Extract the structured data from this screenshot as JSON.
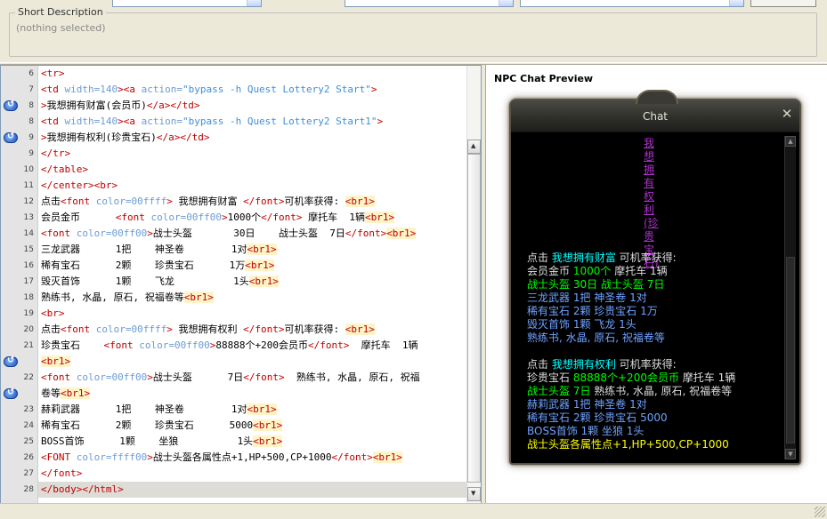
{
  "short_description": {
    "legend": "Short Description",
    "value": "(nothing selected)"
  },
  "editor": {
    "lines": [
      {
        "n": "6",
        "bookmark": false,
        "hl": false,
        "segs": [
          [
            "t",
            "<tr>"
          ]
        ]
      },
      {
        "n": "7",
        "bookmark": false,
        "hl": false,
        "segs": [
          [
            "t",
            "<td "
          ],
          [
            "a",
            "width=140"
          ],
          [
            "t",
            "><a "
          ],
          [
            "a",
            "action="
          ],
          [
            "v",
            "\"bypass -h Quest Lottery2 Start\""
          ],
          [
            "t",
            ">"
          ]
        ]
      },
      {
        "n": "8",
        "bookmark": true,
        "hl": false,
        "segs": [
          [
            "t",
            ">"
          ],
          [
            "x",
            "我想拥有财富(会员币)"
          ],
          [
            "t",
            "</a></td>"
          ]
        ]
      },
      {
        "n": "8",
        "bookmark": false,
        "hl": false,
        "segs": [
          [
            "t",
            "<td "
          ],
          [
            "a",
            "width=140"
          ],
          [
            "t",
            "><a "
          ],
          [
            "a",
            "action="
          ],
          [
            "v",
            "\"bypass -h Quest Lottery2 Start1\""
          ],
          [
            "t",
            ">"
          ]
        ]
      },
      {
        "n": "9",
        "bookmark": true,
        "hl": false,
        "segs": [
          [
            "t",
            ">"
          ],
          [
            "x",
            "我想拥有权利(珍贵宝石)"
          ],
          [
            "t",
            "</a></td>"
          ]
        ]
      },
      {
        "n": "9",
        "bookmark": false,
        "hl": false,
        "segs": [
          [
            "t",
            "</tr>"
          ]
        ]
      },
      {
        "n": "10",
        "bookmark": false,
        "hl": false,
        "segs": [
          [
            "t",
            "</table>"
          ]
        ]
      },
      {
        "n": "11",
        "bookmark": false,
        "hl": false,
        "segs": [
          [
            "t",
            "</center><br>"
          ]
        ]
      },
      {
        "n": "12",
        "bookmark": false,
        "hl": false,
        "segs": [
          [
            "x",
            "点击"
          ],
          [
            "t",
            "<font "
          ],
          [
            "a",
            "color=00ffff"
          ],
          [
            "t",
            "> "
          ],
          [
            "x",
            "我想拥有财富 "
          ],
          [
            "t",
            "</font>"
          ],
          [
            "x",
            "可机率获得: "
          ],
          [
            "b",
            "<br1>"
          ]
        ]
      },
      {
        "n": "13",
        "bookmark": false,
        "hl": false,
        "segs": [
          [
            "x",
            "会员金币      "
          ],
          [
            "t",
            "<font "
          ],
          [
            "a",
            "color=00ff00"
          ],
          [
            "t",
            ">"
          ],
          [
            "x",
            "1000个"
          ],
          [
            "t",
            "</font> "
          ],
          [
            "x",
            "摩托车  1辆"
          ],
          [
            "b",
            "<br1>"
          ]
        ]
      },
      {
        "n": "14",
        "bookmark": false,
        "hl": false,
        "segs": [
          [
            "t",
            "<font "
          ],
          [
            "a",
            "color=00ff00"
          ],
          [
            "t",
            ">"
          ],
          [
            "x",
            "战士头盔       30日    战士头盔  7日"
          ],
          [
            "t",
            "</font>"
          ],
          [
            "b",
            "<br1>"
          ]
        ]
      },
      {
        "n": "15",
        "bookmark": false,
        "hl": false,
        "segs": [
          [
            "x",
            "三龙武器      1把    神圣卷        1对"
          ],
          [
            "b",
            "<br1>"
          ]
        ]
      },
      {
        "n": "16",
        "bookmark": false,
        "hl": false,
        "segs": [
          [
            "x",
            "稀有宝石      2颗    珍贵宝石      1万"
          ],
          [
            "b",
            "<br1>"
          ]
        ]
      },
      {
        "n": "17",
        "bookmark": false,
        "hl": false,
        "segs": [
          [
            "x",
            "毁灭首饰      1颗    飞龙          1头"
          ],
          [
            "b",
            "<br1>"
          ]
        ]
      },
      {
        "n": "18",
        "bookmark": false,
        "hl": false,
        "segs": [
          [
            "x",
            "熟练书, 水晶, 原石, 祝福卷等"
          ],
          [
            "b",
            "<br1>"
          ]
        ]
      },
      {
        "n": "19",
        "bookmark": false,
        "hl": false,
        "segs": [
          [
            "t",
            "<br>"
          ]
        ]
      },
      {
        "n": "20",
        "bookmark": false,
        "hl": false,
        "segs": [
          [
            "x",
            "点击"
          ],
          [
            "t",
            "<font "
          ],
          [
            "a",
            "color=00ffff"
          ],
          [
            "t",
            "> "
          ],
          [
            "x",
            "我想拥有权利 "
          ],
          [
            "t",
            "</font>"
          ],
          [
            "x",
            "可机率获得: "
          ],
          [
            "b",
            "<br1>"
          ]
        ]
      },
      {
        "n": "21",
        "bookmark": false,
        "hl": false,
        "segs": [
          [
            "x",
            "珍贵宝石    "
          ],
          [
            "t",
            "<font "
          ],
          [
            "a",
            "color=00ff00"
          ],
          [
            "t",
            ">"
          ],
          [
            "x",
            "88888个+200会员币"
          ],
          [
            "t",
            "</font>  "
          ],
          [
            "x",
            "摩托车  1辆"
          ]
        ]
      },
      {
        "n": "",
        "bookmark": true,
        "hl": false,
        "segs": [
          [
            "b",
            "<br1>"
          ]
        ]
      },
      {
        "n": "22",
        "bookmark": false,
        "hl": false,
        "segs": [
          [
            "t",
            "<font "
          ],
          [
            "a",
            "color=00ff00"
          ],
          [
            "t",
            ">"
          ],
          [
            "x",
            "战士头盔      7日"
          ],
          [
            "t",
            "</font>  "
          ],
          [
            "x",
            "熟练书, 水晶, 原石, 祝福"
          ]
        ]
      },
      {
        "n": "",
        "bookmark": true,
        "hl": false,
        "segs": [
          [
            "x",
            "卷等"
          ],
          [
            "b",
            "<br1>"
          ]
        ]
      },
      {
        "n": "23",
        "bookmark": false,
        "hl": false,
        "segs": [
          [
            "x",
            "赫莉武器      1把    神圣卷        1对"
          ],
          [
            "b",
            "<br1>"
          ]
        ]
      },
      {
        "n": "24",
        "bookmark": false,
        "hl": false,
        "segs": [
          [
            "x",
            "稀有宝石      2颗    珍贵宝石      5000"
          ],
          [
            "b",
            "<br1>"
          ]
        ]
      },
      {
        "n": "25",
        "bookmark": false,
        "hl": false,
        "segs": [
          [
            "x",
            "BOSS首饰      1颗    坐狼          1头"
          ],
          [
            "b",
            "<br1>"
          ]
        ]
      },
      {
        "n": "26",
        "bookmark": false,
        "hl": false,
        "segs": [
          [
            "t",
            "<FONT "
          ],
          [
            "a",
            "color=ffff00"
          ],
          [
            "t",
            ">"
          ],
          [
            "x",
            "战士头盔各属性点+1,HP+500,CP+1000"
          ],
          [
            "t",
            "</font>"
          ],
          [
            "b",
            "<br1>"
          ]
        ]
      },
      {
        "n": "27",
        "bookmark": false,
        "hl": false,
        "segs": [
          [
            "t",
            "</font>"
          ]
        ]
      },
      {
        "n": "28",
        "bookmark": false,
        "hl": true,
        "segs": [
          [
            "t",
            "</body></html>"
          ]
        ]
      }
    ]
  },
  "preview": {
    "title": "NPC Chat Preview",
    "chat": {
      "title": "Chat",
      "close": "✕",
      "link": "我想拥有权利(珍贵宝石)",
      "lines": [
        [
          [
            "white",
            "点击 "
          ],
          [
            "cyan",
            "我想拥有财富"
          ],
          [
            "white",
            " 可机率获得:"
          ]
        ],
        [
          [
            "white",
            "会员金币 "
          ],
          [
            "green",
            "1000个"
          ],
          [
            "white",
            " 摩托车 1辆"
          ]
        ],
        [
          [
            "green",
            "战士头盔 30日 战士头盔 7日"
          ]
        ],
        [
          [
            "blue",
            "三龙武器 1把 神圣卷 1对"
          ]
        ],
        [
          [
            "blue",
            "稀有宝石 2颗 珍贵宝石 1万"
          ]
        ],
        [
          [
            "blue",
            "毁灭首饰 1颗 飞龙 1头"
          ]
        ],
        [
          [
            "blue",
            "熟练书, 水晶, 原石, 祝福卷等"
          ]
        ],
        [
          [
            "white",
            " "
          ]
        ],
        [
          [
            "white",
            "点击 "
          ],
          [
            "cyan",
            "我想拥有权利"
          ],
          [
            "white",
            " 可机率获得:"
          ]
        ],
        [
          [
            "white",
            "珍贵宝石 "
          ],
          [
            "green",
            "88888个+200会员币"
          ],
          [
            "white",
            " 摩托车 1辆"
          ]
        ],
        [
          [
            "green",
            "战士头盔 7日 "
          ],
          [
            "white",
            "熟练书, 水晶, 原石, 祝福卷等"
          ]
        ],
        [
          [
            "blue",
            "赫莉武器 1把 神圣卷 1对"
          ]
        ],
        [
          [
            "blue",
            "稀有宝石 2颗 珍贵宝石 5000"
          ]
        ],
        [
          [
            "blue",
            "BOSS首饰 1颗 坐狼 1头"
          ]
        ],
        [
          [
            "yellow",
            "战士头盔各属性点+1,HP+500,CP+1000"
          ]
        ]
      ]
    }
  },
  "colors": {
    "tag": "#c00000",
    "attr": "#6b9bd6",
    "value": "#3d8fd9",
    "chat_cyan": "#00ffff",
    "chat_green": "#00ff00",
    "chat_yellow": "#ffff00",
    "chat_link": "#b02fd0"
  }
}
